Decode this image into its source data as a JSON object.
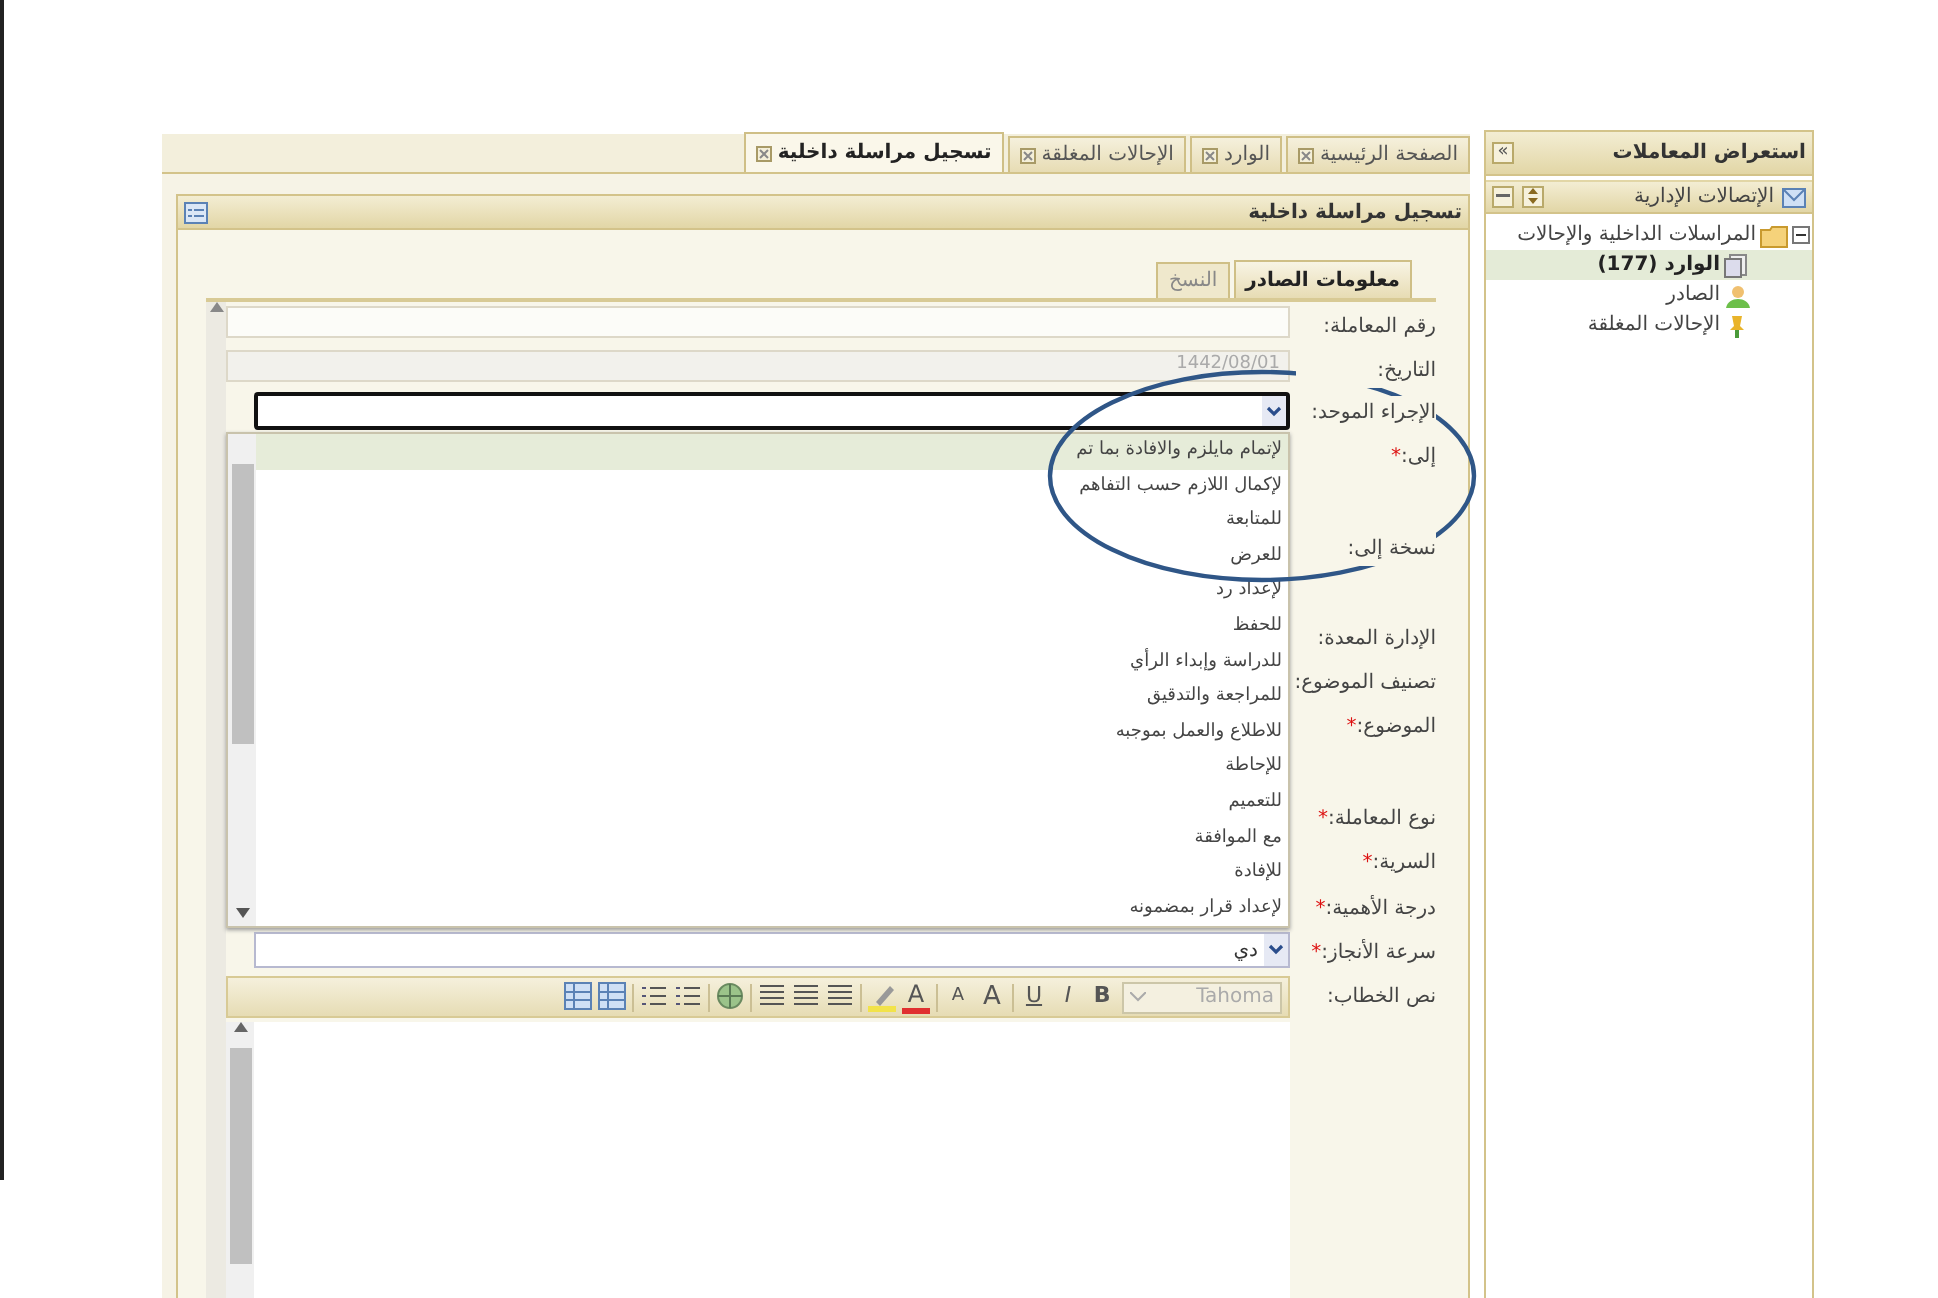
{
  "side_panel": {
    "title": "استعراض المعاملات",
    "collapse": "»",
    "section": "الإتصالات الإدارية",
    "tree": [
      {
        "label": "المراسلات الداخلية والإحالات",
        "expanded": true,
        "kind": "folder",
        "children": [
          {
            "label": "الوارد (177)",
            "selected": true,
            "kind": "documents"
          },
          {
            "label": "الصادر",
            "selected": false,
            "kind": "person"
          },
          {
            "label": "الإحالات المغلقة",
            "selected": false,
            "kind": "pin"
          }
        ]
      }
    ]
  },
  "tabs": [
    {
      "label": "الصفحة الرئيسية",
      "selected": false
    },
    {
      "label": "الوارد",
      "selected": false
    },
    {
      "label": "الإحالات المغلقة",
      "selected": false
    },
    {
      "label": "تسجيل مراسلة داخلية",
      "selected": true
    }
  ],
  "panel": {
    "title": "تسجيل مراسلة داخلية",
    "subtabs": [
      {
        "label": "معلومات الصادر",
        "selected": true
      },
      {
        "label": "النسخ",
        "selected": false
      }
    ],
    "fields": [
      {
        "label": "رقم المعاملة:",
        "kind": "text"
      },
      {
        "label": "التاريخ:",
        "kind": "text",
        "value": "1442/08/01",
        "disabled": true
      },
      {
        "label": "الإجراء الموحد:",
        "kind": "select",
        "open": true,
        "options": [
          {
            "label": "لإتمام مايلزم والافادة بما تم",
            "selected": true
          },
          {
            "label": "لإكمال اللازم حسب التفاهم",
            "selected": false
          },
          {
            "label": "للمتابعة",
            "selected": false
          },
          {
            "label": "للعرض",
            "selected": false
          },
          {
            "label": "لإعداد رد",
            "selected": false
          },
          {
            "label": "للحفظ",
            "selected": false
          },
          {
            "label": "للدراسة وإبداء الرأي",
            "selected": false
          },
          {
            "label": "للمراجعة والتدقيق",
            "selected": false
          },
          {
            "label": "للاطلاع والعمل بموجبه",
            "selected": false
          },
          {
            "label": "للإحاطة",
            "selected": false
          },
          {
            "label": "للتعميم",
            "selected": false
          },
          {
            "label": "مع الموافقة",
            "selected": false
          },
          {
            "label": "للإفادة",
            "selected": false
          },
          {
            "label": "لإعداد قرار بمضمونه",
            "selected": false
          }
        ]
      },
      {
        "label": "إلى:",
        "required": "*"
      },
      {
        "label": "نسخة إلى:"
      },
      {
        "label": "الإدارة المعدة:"
      },
      {
        "label": "تصنيف الموضوع:"
      },
      {
        "label": "الموضوع:",
        "required": "*"
      },
      {
        "label": "نوع المعاملة:",
        "required": "*"
      },
      {
        "label": "السرية:",
        "required": "*"
      },
      {
        "label": "درجة الأهمية:",
        "required": "*"
      },
      {
        "label": "سرعة الأنجاز:",
        "required": "*",
        "kind": "select",
        "value": "دي"
      },
      {
        "label": "نص الخطاب:",
        "kind": "editor",
        "toolbar": [
          {
            "kind": "font",
            "label": "Tahoma"
          },
          {
            "kind": "bold",
            "label": "B"
          },
          {
            "kind": "italic",
            "label": "I"
          },
          {
            "kind": "underline",
            "label": "U"
          },
          {
            "kind": "sep"
          },
          {
            "kind": "grow",
            "label": "A"
          },
          {
            "kind": "shrink",
            "label": "A"
          },
          {
            "kind": "sep"
          },
          {
            "kind": "color",
            "label": "A"
          },
          {
            "kind": "highlight"
          },
          {
            "kind": "sep"
          },
          {
            "kind": "align"
          },
          {
            "kind": "align"
          },
          {
            "kind": "align"
          },
          {
            "kind": "sep"
          },
          {
            "kind": "link"
          },
          {
            "kind": "sep"
          },
          {
            "kind": "list"
          },
          {
            "kind": "list"
          },
          {
            "kind": "sep"
          },
          {
            "kind": "table"
          },
          {
            "kind": "table"
          }
        ]
      }
    ]
  },
  "annotations": [
    {
      "kind": "ellipse"
    }
  ]
}
